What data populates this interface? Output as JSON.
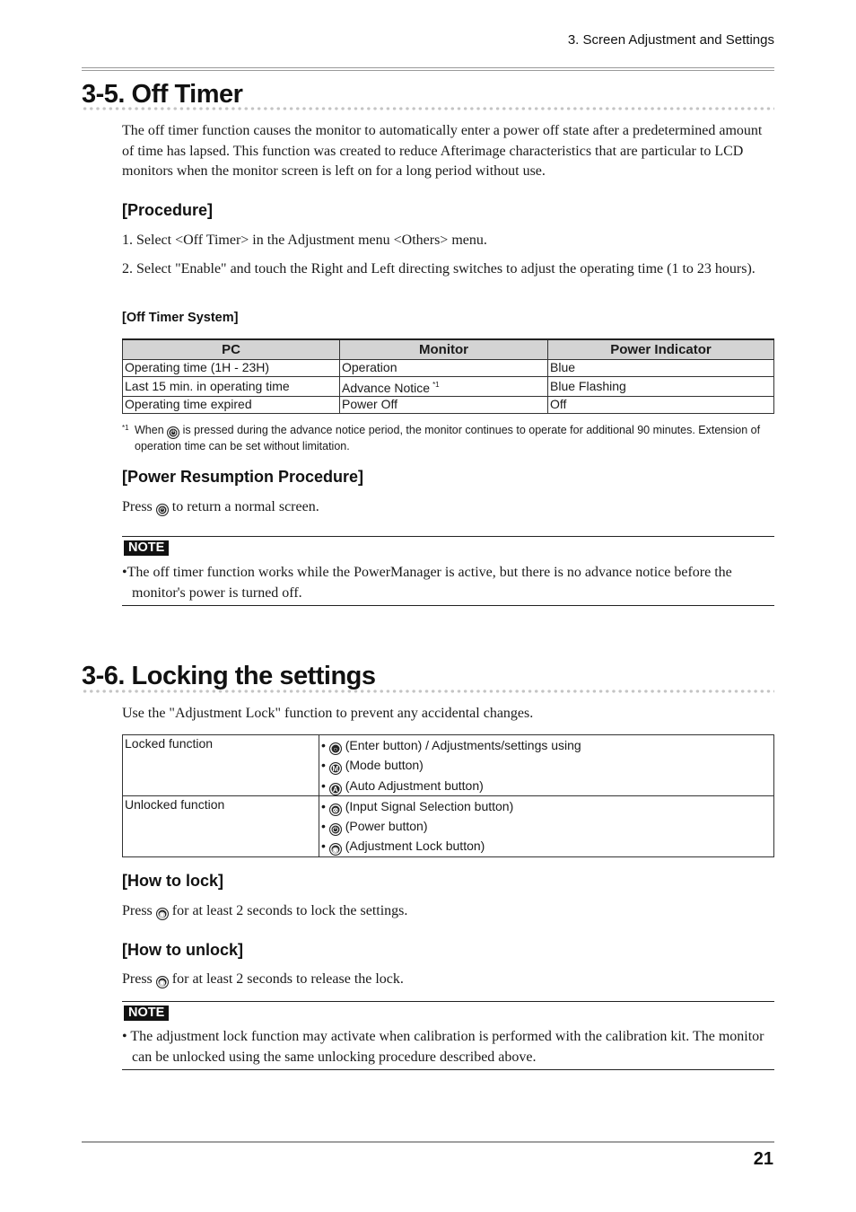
{
  "header": {
    "running_title": "3. Screen Adjustment and Settings"
  },
  "section_off_timer": {
    "title": "3-5. Off Timer",
    "intro": "The off timer function causes the monitor to automatically enter a power off state after a predetermined amount of time has lapsed. This function was created to reduce Afterimage characteristics that are particular to LCD monitors when the monitor screen is left on for a long period without use.",
    "procedure_heading": "[Procedure]",
    "steps": [
      "1. Select <Off Timer> in the Adjustment menu <Others> menu.",
      "2. Select \"Enable\" and touch the Right and Left directing switches to adjust the operating time (1 to 23 hours)."
    ],
    "table_heading": "[Off Timer System]",
    "table": {
      "headers": [
        "PC",
        "Monitor",
        "Power Indicator"
      ],
      "rows": [
        [
          "Operating time (1H - 23H)",
          "Operation",
          "Blue"
        ],
        [
          "Last 15 min. in operating time",
          "Advance Notice",
          "Blue Flashing"
        ],
        [
          "Operating time expired",
          "Power Off",
          "Off"
        ]
      ],
      "note_ref": "*1"
    },
    "footnote": {
      "mark": "*1",
      "before_icon": "When",
      "icon": "power-button-icon",
      "after_icon": "is pressed during the advance notice period, the monitor continues to operate for additional 90 minutes. Extension of operation time can be set without limitation."
    },
    "resumption_heading": "[Power Resumption Procedure]",
    "resumption": {
      "before_icon": "Press",
      "icon": "power-button-icon",
      "after_icon": "to return a normal screen."
    },
    "note": {
      "badge": "NOTE",
      "text": "•The off timer function works while the PowerManager is active, but there is no advance notice before the monitor's power is turned off."
    }
  },
  "section_locking": {
    "title": "3-6. Locking the settings",
    "intro": "Use the \"Adjustment Lock\" function to prevent any accidental changes.",
    "table": {
      "rows": [
        {
          "label": "Locked function",
          "items": [
            {
              "icon": "enter-button-icon",
              "glyph": "○",
              "text": "(Enter button) / Adjustments/settings using"
            },
            {
              "icon": "mode-button-icon",
              "glyph": "M",
              "text": "(Mode button)"
            },
            {
              "icon": "auto-adjust-button-icon",
              "glyph": "A",
              "text": "(Auto Adjustment button)"
            }
          ]
        },
        {
          "label": "Unlocked function",
          "items": [
            {
              "icon": "input-select-button-icon",
              "glyph": "⊗",
              "text": "(Input Signal Selection button)"
            },
            {
              "icon": "power-button-icon",
              "glyph": "⏻",
              "text": "(Power button)"
            },
            {
              "icon": "adjustment-lock-button-icon",
              "glyph": "🔒",
              "text": "(Adjustment Lock button)"
            }
          ]
        }
      ]
    },
    "how_to_lock_heading": "[How to lock]",
    "how_to_lock": {
      "before_icon": "Press",
      "icon": "adjustment-lock-button-icon",
      "after_icon": "for at least 2 seconds to lock the settings."
    },
    "how_to_unlock_heading": "[How to unlock]",
    "how_to_unlock": {
      "before_icon": "Press",
      "icon": "adjustment-lock-button-icon",
      "after_icon": "for at least 2 seconds to release the lock."
    },
    "note": {
      "badge": "NOTE",
      "text": "• The adjustment lock function may activate when calibration is performed with the calibration kit. The monitor can be unlocked using the same unlocking procedure described above."
    }
  },
  "footer": {
    "page_number": "21"
  }
}
